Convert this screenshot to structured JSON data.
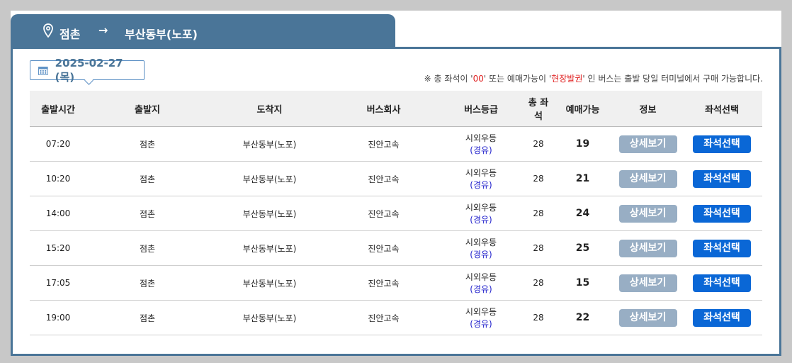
{
  "route": {
    "origin": "점촌",
    "arrow": "→",
    "destination": "부산동부(노포)"
  },
  "date": "2025-02-27 (목)",
  "notice": {
    "part1": "※ 총 좌석이 '",
    "zero": "00",
    "part2": "' 또는 예매가능이 '",
    "onsite": "현장발권",
    "part3": "' 인 버스는 출발 당일 터미널에서 구매 가능합니다."
  },
  "columns": [
    "출발시간",
    "출발지",
    "도착지",
    "버스회사",
    "버스등급",
    "총 좌석",
    "예매가능",
    "정보",
    "좌석선택"
  ],
  "buttons": {
    "detail": "상세보기",
    "seat": "좌석선택"
  },
  "rows": [
    {
      "time": "07:20",
      "from": "점촌",
      "to": "부산동부(노포)",
      "company": "진안고속",
      "grade": "시외우등",
      "grade_note": "(경유)",
      "total": "28",
      "available": "19"
    },
    {
      "time": "10:20",
      "from": "점촌",
      "to": "부산동부(노포)",
      "company": "진안고속",
      "grade": "시외우등",
      "grade_note": "(경유)",
      "total": "28",
      "available": "21"
    },
    {
      "time": "14:00",
      "from": "점촌",
      "to": "부산동부(노포)",
      "company": "진안고속",
      "grade": "시외우등",
      "grade_note": "(경유)",
      "total": "28",
      "available": "24"
    },
    {
      "time": "15:20",
      "from": "점촌",
      "to": "부산동부(노포)",
      "company": "진안고속",
      "grade": "시외우등",
      "grade_note": "(경유)",
      "total": "28",
      "available": "25"
    },
    {
      "time": "17:05",
      "from": "점촌",
      "to": "부산동부(노포)",
      "company": "진안고속",
      "grade": "시외우등",
      "grade_note": "(경유)",
      "total": "28",
      "available": "15"
    },
    {
      "time": "19:00",
      "from": "점촌",
      "to": "부산동부(노포)",
      "company": "진안고속",
      "grade": "시외우등",
      "grade_note": "(경유)",
      "total": "28",
      "available": "22"
    }
  ]
}
